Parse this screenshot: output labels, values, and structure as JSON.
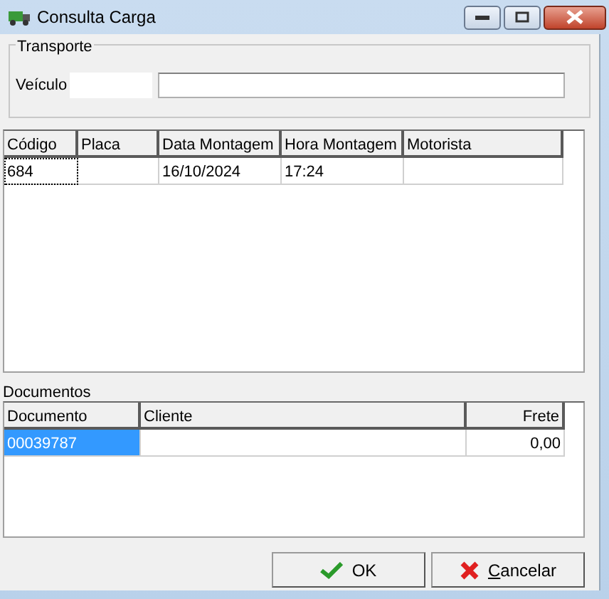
{
  "window": {
    "title": "Consulta Carga"
  },
  "transporte": {
    "legend": "Transporte",
    "label": "Veículo"
  },
  "cargas": {
    "columns": [
      "Código",
      "Placa",
      "Data Montagem",
      "Hora Montagem",
      "Motorista"
    ],
    "rows": [
      {
        "cells": [
          "684",
          "",
          "16/10/2024",
          "17:24",
          ""
        ],
        "focused": true
      }
    ]
  },
  "documentos": {
    "label": "Documentos",
    "columns": [
      "Documento",
      "Cliente",
      "Frete"
    ],
    "rows": [
      {
        "cells": [
          "00039787",
          "",
          "0,00"
        ],
        "selected": true
      }
    ]
  },
  "buttons": [
    {
      "kind": "ok",
      "label": "OK",
      "underline_first": false
    },
    {
      "kind": "cancel",
      "label": "Cancelar",
      "underline_first": true
    }
  ]
}
